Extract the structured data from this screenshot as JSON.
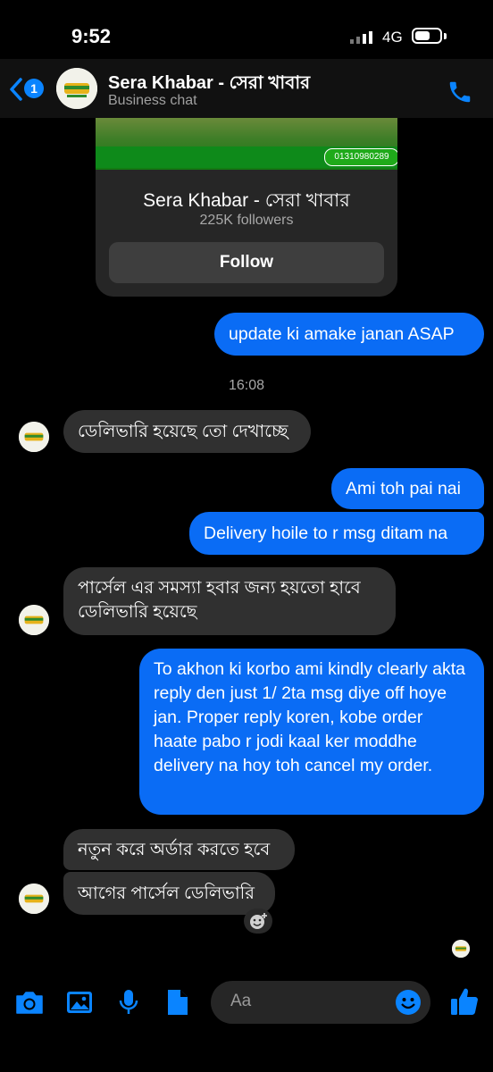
{
  "status_bar": {
    "time": "9:52",
    "network": "4G"
  },
  "header": {
    "unread_count": "1",
    "contact_name": "Sera Khabar - সেরা খাবার",
    "contact_subtitle": "Business chat"
  },
  "profile_card": {
    "banner_phone": "01310980289",
    "name": "Sera Khabar - সেরা খাবার",
    "followers": "225K followers",
    "follow_label": "Follow"
  },
  "messages": [
    {
      "id": "m1",
      "direction": "outgoing",
      "text": "update ki amake janan ASAP"
    },
    {
      "id": "t1",
      "type": "timestamp",
      "text": "16:08"
    },
    {
      "id": "m2",
      "direction": "incoming",
      "text": "ডেলিভারি হয়েছে তো দেখাচ্ছে"
    },
    {
      "id": "m3",
      "direction": "outgoing",
      "text": "Ami toh pai nai"
    },
    {
      "id": "m4",
      "direction": "outgoing",
      "text": "Delivery hoile to r msg ditam na"
    },
    {
      "id": "m5",
      "direction": "incoming",
      "text": "পার্সেল এর সমস্যা হবার জন্য হয়তো হাবে ডেলিভারি হয়েছে"
    },
    {
      "id": "m6",
      "direction": "outgoing",
      "text": "To akhon ki korbo ami kindly clearly akta reply den just 1/ 2ta msg diye off hoye jan. Proper reply koren, kobe order haate pabo r jodi kaal ker moddhe delivery na hoy toh cancel my order."
    },
    {
      "id": "m7",
      "direction": "incoming",
      "text": "নতুন করে অর্ডার করতে হবে"
    },
    {
      "id": "m8",
      "direction": "incoming",
      "text": "আগের পার্সেল ডেলিভারি"
    }
  ],
  "composer": {
    "placeholder": "Aa"
  },
  "colors": {
    "accent": "#0a84ff",
    "outgoing_bubble": "#0a6cf5",
    "incoming_bubble": "#303030",
    "background": "#000000"
  },
  "icons": [
    "chevron-left-icon",
    "phone-icon",
    "camera-icon",
    "image-icon",
    "microphone-icon",
    "file-icon",
    "emoji-icon",
    "thumbs-up-icon",
    "add-reaction-icon"
  ]
}
